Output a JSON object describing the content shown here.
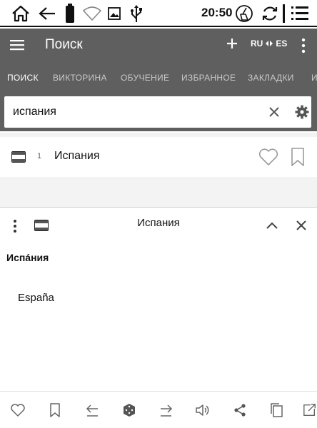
{
  "status_bar": {
    "time": "20:50",
    "icons": [
      "home-outline-icon",
      "back-arrow-icon",
      "battery-icon",
      "wifi-icon",
      "image-icon",
      "usb-icon",
      "clean-icon",
      "sync-icon",
      "list-menu-icon"
    ]
  },
  "header": {
    "title": "Поиск",
    "add_icon": "plus-icon",
    "lang_from": "RU",
    "lang_to": "ES",
    "swap_icon": "swap-arrows-icon",
    "more_icon": "vertical-dots-icon"
  },
  "tabs": [
    {
      "label": "ПОИСК",
      "active": true
    },
    {
      "label": "ВИКТОРИНА",
      "active": false
    },
    {
      "label": "ОБУЧЕНИЕ",
      "active": false
    },
    {
      "label": "ИЗБРАННОЕ",
      "active": false
    },
    {
      "label": "ЗАКЛАДКИ",
      "active": false
    },
    {
      "label": "И",
      "active": false
    }
  ],
  "search": {
    "value": "испания",
    "placeholder": ""
  },
  "results": [
    {
      "index": "1",
      "word": "Испания",
      "flag_icon": "dictionary-flag-icon"
    }
  ],
  "card": {
    "title": "Испания",
    "headword": "Испáния",
    "translation": "España"
  },
  "bottom_bar": {
    "icons": [
      "heart-icon",
      "bookmark-icon",
      "prev-arrow-icon",
      "random-dice-icon",
      "next-arrow-icon",
      "speaker-icon",
      "share-icon",
      "copy-icon",
      "open-external-icon"
    ]
  },
  "colors": {
    "appbar": "#5f5f5f",
    "tab_active": "#ffffff",
    "tab_inactive": "#c9c9c9",
    "text": "#111111",
    "icon_muted": "#9a9a9a"
  }
}
